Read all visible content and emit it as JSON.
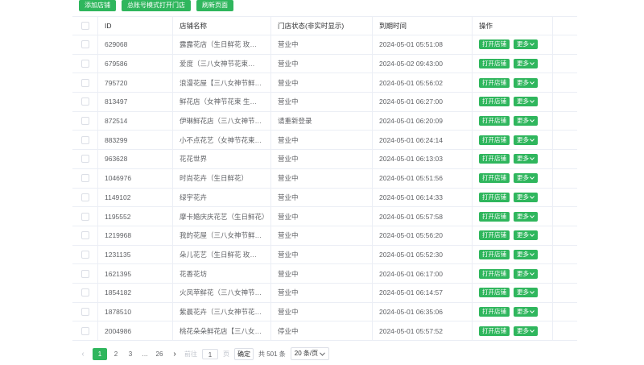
{
  "toolbar": {
    "add_store": "添加店铺",
    "open_with_account": "总账号模式打开门店",
    "refresh": "刷新页面"
  },
  "table": {
    "headers": {
      "id": "ID",
      "name": "店铺名称",
      "status": "门店状态(非实时显示)",
      "expire": "到期时间",
      "action": "操作"
    },
    "open_label": "打开店铺",
    "more_label": "更多",
    "rows": [
      {
        "id": "629068",
        "name": "露露花店（生日鲜花 玫…",
        "status": "营业中",
        "expire": "2024-05-01 05:51:08"
      },
      {
        "id": "679586",
        "name": "爱度（三八女神节花束…",
        "status": "营业中",
        "expire": "2024-05-02 09:43:00"
      },
      {
        "id": "795720",
        "name": "浪漫花屋【三八女神节鲜…",
        "status": "营业中",
        "expire": "2024-05-01 05:56:02"
      },
      {
        "id": "813497",
        "name": "鲜花店（女神节花束 生…",
        "status": "营业中",
        "expire": "2024-05-01 06:27:00"
      },
      {
        "id": "872514",
        "name": "伊琳鲜花店（三八女神节…",
        "status": "请重新登录",
        "expire": "2024-05-01 06:20:09"
      },
      {
        "id": "883299",
        "name": "小不点花艺（女神节花束…",
        "status": "营业中",
        "expire": "2024-05-01 06:24:14"
      },
      {
        "id": "963628",
        "name": "花花世界",
        "status": "营业中",
        "expire": "2024-05-01 06:13:03"
      },
      {
        "id": "1046976",
        "name": "时尚花卉（生日鲜花）",
        "status": "营业中",
        "expire": "2024-05-01 05:51:56"
      },
      {
        "id": "1149102",
        "name": "绿宇花卉",
        "status": "营业中",
        "expire": "2024-05-01 06:14:33"
      },
      {
        "id": "1195552",
        "name": "摩卡婚庆庆花艺（生日鲜花）",
        "status": "营业中",
        "expire": "2024-05-01 05:57:58"
      },
      {
        "id": "1219968",
        "name": "我的花屋（三八女神节鲜…",
        "status": "营业中",
        "expire": "2024-05-01 05:56:20"
      },
      {
        "id": "1231135",
        "name": "朵儿花艺（生日鲜花 玫…",
        "status": "营业中",
        "expire": "2024-05-01 05:52:30"
      },
      {
        "id": "1621395",
        "name": "花香花坊",
        "status": "营业中",
        "expire": "2024-05-01 06:17:00"
      },
      {
        "id": "1854182",
        "name": "火凤苹鲜花（三八女神节…",
        "status": "营业中",
        "expire": "2024-05-01 06:14:57"
      },
      {
        "id": "1878510",
        "name": "紫晨花卉（三八女神节花…",
        "status": "营业中",
        "expire": "2024-05-01 06:35:06"
      },
      {
        "id": "2004986",
        "name": "桃花朵朵鲜花店【三八女…",
        "status": "停业中",
        "expire": "2024-05-01 05:57:52"
      }
    ]
  },
  "pager": {
    "prev_icon": "chevron-left-icon",
    "next_icon": "chevron-right-icon",
    "pages": [
      "1",
      "2",
      "3",
      "…",
      "26"
    ],
    "current": "1",
    "goto_label": "前往",
    "goto_value": "1",
    "page_unit": "页",
    "confirm": "确定",
    "total": "共 501 条",
    "page_size": "20 条/页"
  },
  "colors": {
    "accent": "#2fb65d"
  }
}
